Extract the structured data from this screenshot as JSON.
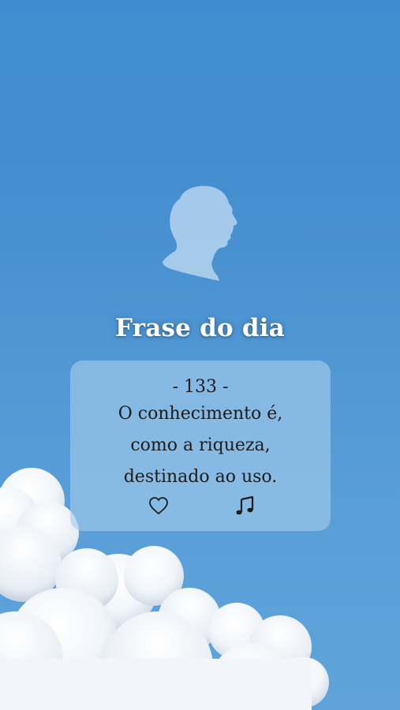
{
  "screen": {
    "title": "Frase do dia",
    "background_color": "#4a93d2"
  },
  "quote_card": {
    "number": "- 133 -",
    "lines": [
      "O conhecimento é,",
      "como a riqueza,",
      "destinado ao uso."
    ],
    "card_color": "#a5cdec"
  },
  "actions": {
    "favorite_icon": "heart-outline-icon",
    "audio_icon": "music-note-icon"
  },
  "decor": {
    "author_portrait": "author-silhouette-icon",
    "clouds": "clouds-image"
  }
}
